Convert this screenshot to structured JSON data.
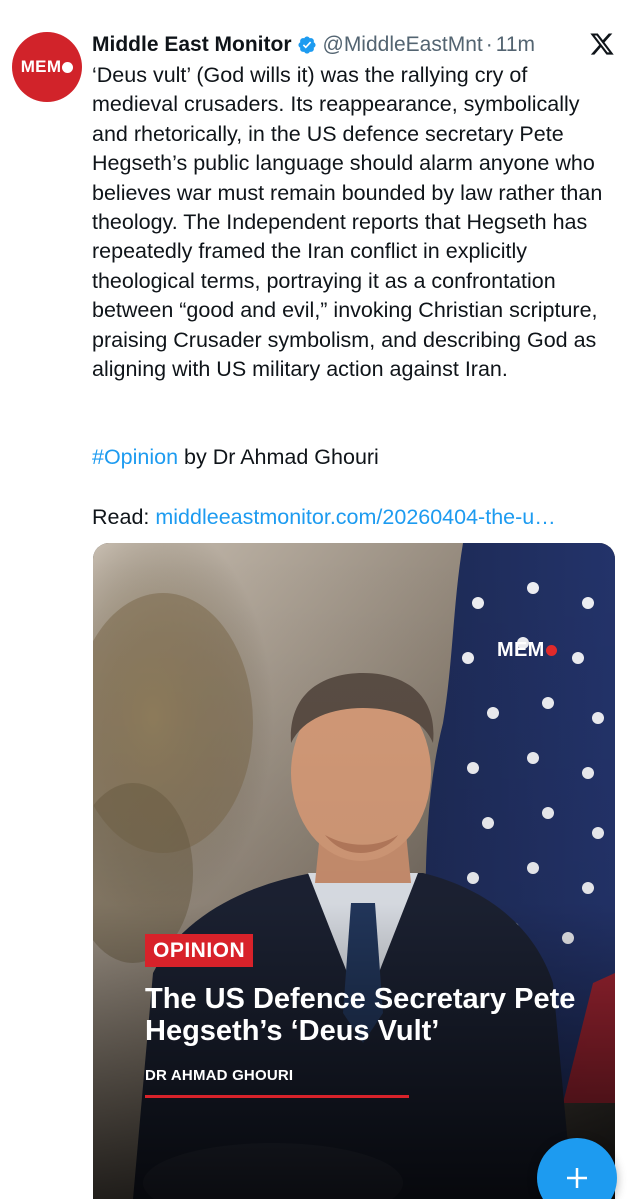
{
  "tweet": {
    "author": {
      "avatar_text": "MEM",
      "display_name": "Middle East Monitor",
      "handle": "@MiddleEastMnt",
      "separator": "·",
      "time": "11m"
    },
    "text": "‘Deus vult’ (God wills it) was the rallying cry of medieval crusaders. Its reappearance, symbolically and rhetorically, in the US defence secretary Pete Hegseth’s public language should alarm anyone who believes war must remain bounded by law rather than theology. The Independent reports that Hegseth has repeatedly framed the Iran conflict in explicitly theological terms, portraying it as a confrontation between “good and evil,” invoking Christian scripture, praising Crusader symbolism, and describing God as aligning with US military action against Iran.",
    "hashtag": "#Opinion",
    "byline_text": " by Dr Ahmad Ghouri",
    "read_label": "Read: ",
    "link_text": "middleeastmonitor.com/20260404-the-u…"
  },
  "media": {
    "logo_text": "MEM",
    "badge": "OPINION",
    "headline": "The US Defence Secretary Pete Hegseth’s ‘Deus Vult’",
    "author": "DR AHMAD GHOURI"
  },
  "colors": {
    "brand_red": "#d1232a",
    "link_blue": "#1d9bf0",
    "verified_blue": "#1d9bf0"
  },
  "icons": {
    "verified": "verified-badge-icon",
    "platform": "x-logo-icon",
    "compose": "plus-icon"
  }
}
